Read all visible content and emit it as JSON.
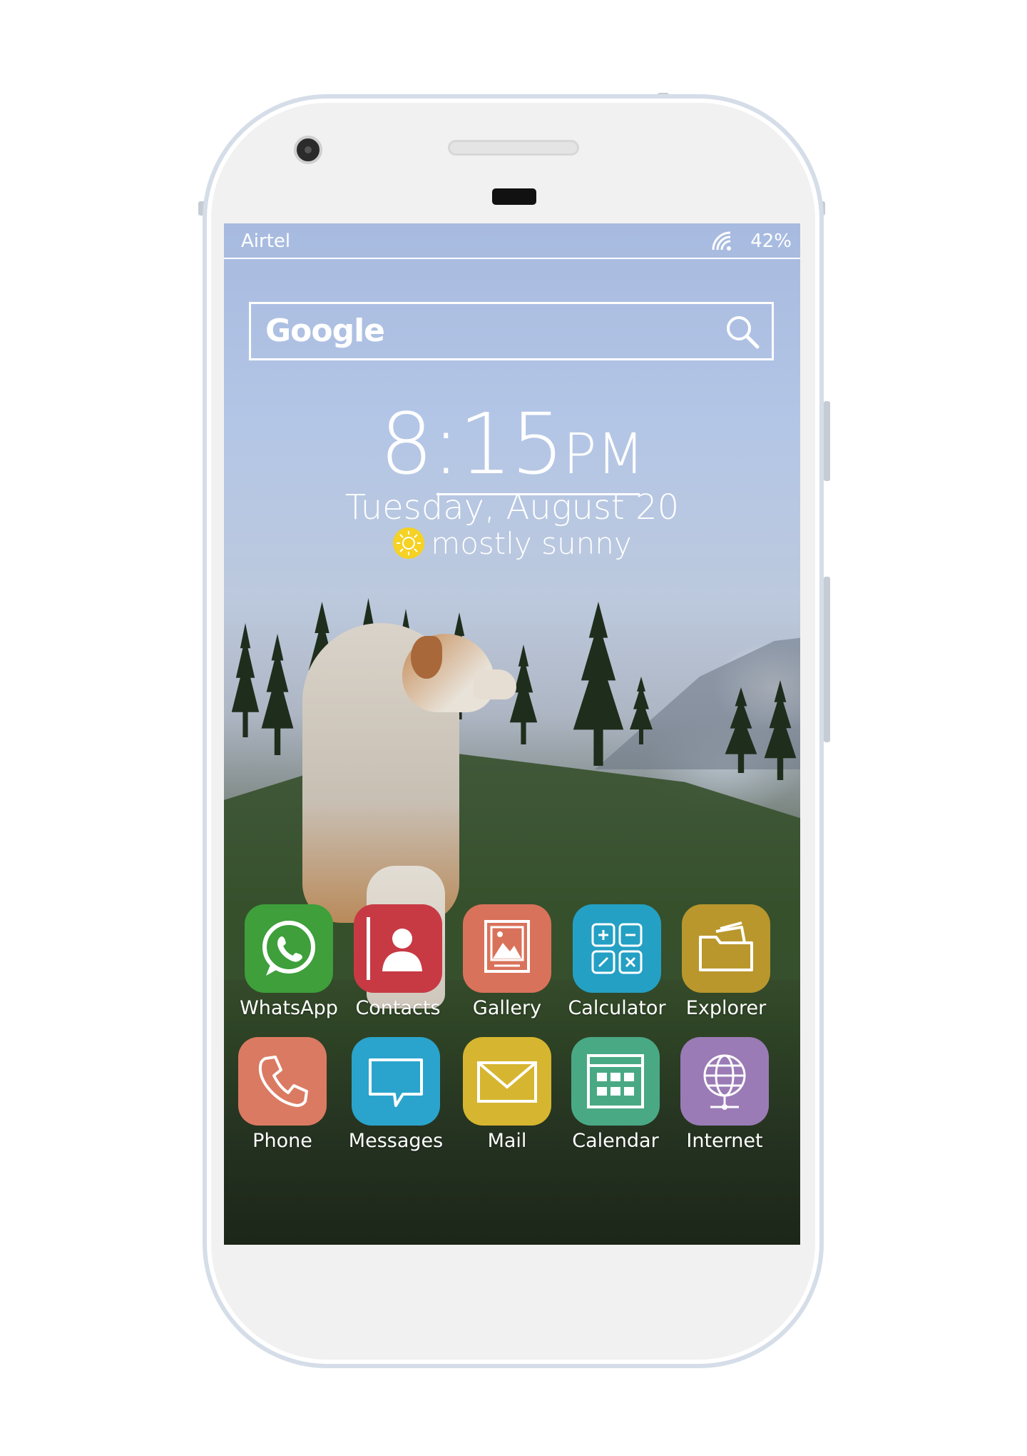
{
  "status_bar": {
    "carrier": "Airtel",
    "battery": "42%",
    "signal_icon": "wifi-signal-icon"
  },
  "search_widget": {
    "logo": "Google",
    "search_icon": "search-icon"
  },
  "clock_widget": {
    "time": "8:15",
    "ampm": "PM",
    "date": "Tuesday, August 20",
    "weather_text": "mostly sunny",
    "weather_icon": "sun-icon"
  },
  "apps": [
    {
      "label": "WhatsApp",
      "icon": "whatsapp-icon",
      "color": "#3e9f3b"
    },
    {
      "label": "Contacts",
      "icon": "contacts-icon",
      "color": "#c73a44"
    },
    {
      "label": "Gallery",
      "icon": "gallery-icon",
      "color": "#d9725b"
    },
    {
      "label": "Calculator",
      "icon": "calculator-icon",
      "color": "#24a0c4"
    },
    {
      "label": "Explorer",
      "icon": "folder-icon",
      "color": "#b9972c"
    },
    {
      "label": "Phone",
      "icon": "phone-icon",
      "color": "#db7a62"
    },
    {
      "label": "Messages",
      "icon": "message-icon",
      "color": "#2aa4cc"
    },
    {
      "label": "Mail",
      "icon": "mail-icon",
      "color": "#d6b530"
    },
    {
      "label": "Calendar",
      "icon": "calendar-icon",
      "color": "#4aa985"
    },
    {
      "label": "Internet",
      "icon": "globe-icon",
      "color": "#9a7bb6"
    }
  ]
}
